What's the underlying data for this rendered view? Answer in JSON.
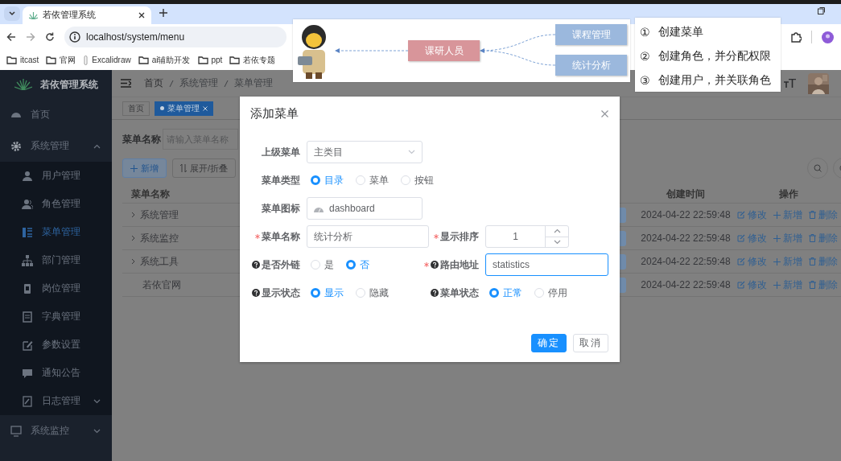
{
  "browser": {
    "tab_title": "若依管理系统",
    "url": "localhost/system/menu",
    "bookmarks": [
      {
        "label": "itcast",
        "kind": "folder"
      },
      {
        "label": "官网",
        "kind": "folder"
      },
      {
        "label": "Excalidraw",
        "kind": "page"
      },
      {
        "label": "ai辅助开发",
        "kind": "folder"
      },
      {
        "label": "ppt",
        "kind": "folder"
      },
      {
        "label": "若依专题",
        "kind": "folder"
      }
    ]
  },
  "sidebar": {
    "title": "若依管理系统",
    "items": [
      {
        "label": "首页",
        "selected": false
      },
      {
        "label": "系统管理",
        "selected": false,
        "expanded": true,
        "children": [
          {
            "label": "用户管理",
            "selected": false
          },
          {
            "label": "角色管理",
            "selected": false
          },
          {
            "label": "菜单管理",
            "selected": true
          },
          {
            "label": "部门管理",
            "selected": false
          },
          {
            "label": "岗位管理",
            "selected": false
          },
          {
            "label": "字典管理",
            "selected": false
          },
          {
            "label": "参数设置",
            "selected": false
          },
          {
            "label": "通知公告",
            "selected": false
          },
          {
            "label": "日志管理",
            "selected": false,
            "expanded": false
          }
        ]
      },
      {
        "label": "系统监控",
        "selected": false,
        "expanded": false
      }
    ]
  },
  "header": {
    "breadcrumb": [
      "首页",
      "系统管理",
      "菜单管理"
    ]
  },
  "tags": [
    {
      "label": "首页",
      "selected": false
    },
    {
      "label": "菜单管理",
      "selected": true
    }
  ],
  "search": {
    "label": "菜单名称",
    "placeholder": "请输入菜单名称"
  },
  "toolbar": {
    "buttons": [
      {
        "label": "新增",
        "kind": "primary"
      },
      {
        "label": "展开/折叠",
        "kind": "plain"
      }
    ]
  },
  "table": {
    "columns": [
      "菜单名称",
      "创建时间",
      "操作"
    ],
    "rows": [
      {
        "name": "系统管理",
        "expandable": true,
        "created": "2024-04-22 22:59:48",
        "actions": [
          "修改",
          "新增",
          "删除"
        ]
      },
      {
        "name": "系统监控",
        "expandable": true,
        "created": "2024-04-22 22:59:48",
        "actions": [
          "修改",
          "新增",
          "删除"
        ]
      },
      {
        "name": "系统工具",
        "expandable": true,
        "created": "2024-04-22 22:59:48",
        "actions": [
          "修改",
          "新增",
          "删除"
        ]
      },
      {
        "name": "若依官网",
        "expandable": false,
        "created": "2024-04-22 22:59:48",
        "actions": [
          "修改",
          "新增",
          "删除"
        ]
      }
    ]
  },
  "dialog": {
    "title": "添加菜单",
    "rows": [
      [
        {
          "label": "上级菜单",
          "kind": "select",
          "required": false,
          "help": false,
          "value": "主类目"
        }
      ],
      [
        {
          "label": "菜单类型",
          "kind": "radio",
          "required": false,
          "help": false,
          "options": [
            {
              "label": "目录",
              "selected": true
            },
            {
              "label": "菜单",
              "selected": false
            },
            {
              "label": "按钮",
              "selected": false
            }
          ]
        }
      ],
      [
        {
          "label": "菜单图标",
          "kind": "icon-input",
          "required": false,
          "help": false,
          "value": "dashboard"
        }
      ],
      [
        {
          "label": "菜单名称",
          "kind": "text",
          "required": true,
          "help": false,
          "focused": false,
          "value": "统计分析"
        },
        {
          "label": "显示排序",
          "kind": "number",
          "required": true,
          "help": false,
          "value": "1"
        }
      ],
      [
        {
          "label": "是否外链",
          "kind": "radio",
          "required": false,
          "help": true,
          "options": [
            {
              "label": "是",
              "selected": false
            },
            {
              "label": "否",
              "selected": true
            }
          ]
        },
        {
          "label": "路由地址",
          "kind": "text",
          "required": true,
          "help": true,
          "focused": true,
          "value": "statistics"
        }
      ],
      [
        {
          "label": "显示状态",
          "kind": "radio",
          "required": false,
          "help": true,
          "options": [
            {
              "label": "显示",
              "selected": true
            },
            {
              "label": "隐藏",
              "selected": false
            }
          ]
        },
        {
          "label": "菜单状态",
          "kind": "radio",
          "required": false,
          "help": true,
          "options": [
            {
              "label": "正常",
              "selected": true
            },
            {
              "label": "停用",
              "selected": false
            }
          ]
        }
      ]
    ],
    "buttons": [
      {
        "label": "确定",
        "kind": "primary"
      },
      {
        "label": "取消",
        "kind": "plain"
      }
    ]
  },
  "diagram": {
    "nodes": [
      {
        "label": "课研人员",
        "color": "#d8959a"
      },
      {
        "label": "课程管理",
        "color": "#9bb8dd"
      },
      {
        "label": "统计分析",
        "color": "#9bb8dd"
      }
    ]
  },
  "steps": [
    {
      "marker": "①",
      "text": "创建菜单"
    },
    {
      "marker": "②",
      "text": "创建角色，并分配权限"
    },
    {
      "marker": "③",
      "text": "创建用户，并关联角色"
    }
  ]
}
